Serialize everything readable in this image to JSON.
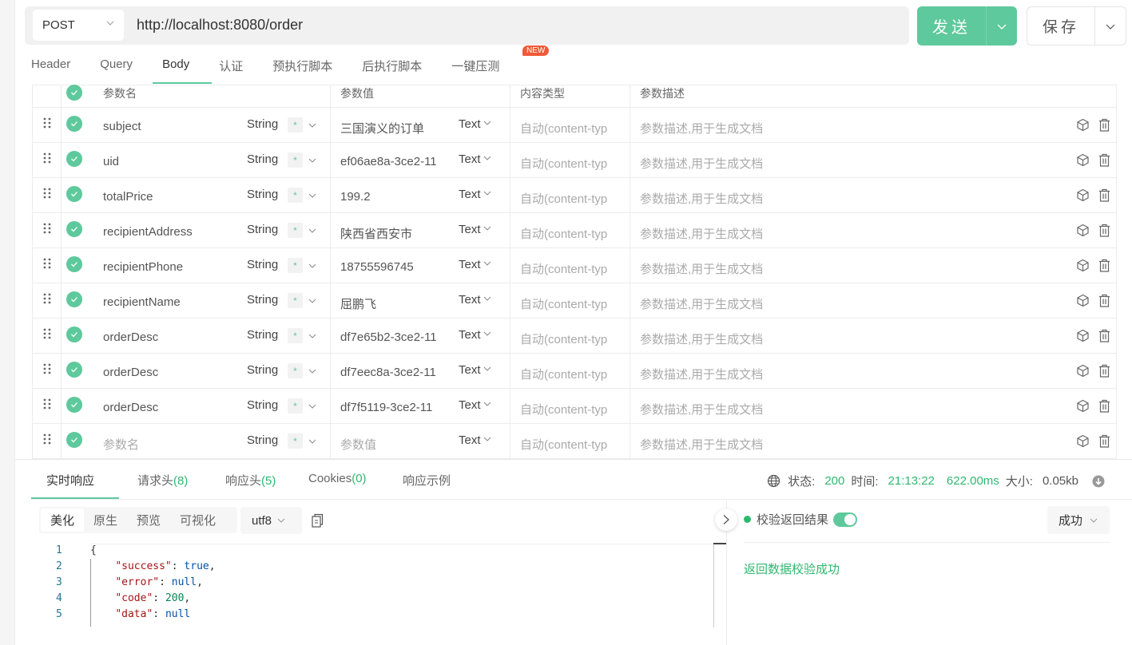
{
  "request": {
    "method": "POST",
    "url": "http://localhost:8080/order",
    "send_label": "发送",
    "save_label": "保存"
  },
  "tabs": [
    {
      "label": "Header"
    },
    {
      "label": "Query"
    },
    {
      "label": "Body",
      "active": true
    },
    {
      "label": "认证"
    },
    {
      "label": "预执行脚本"
    },
    {
      "label": "后执行脚本"
    },
    {
      "label": "一键压测"
    }
  ],
  "new_badge": "NEW",
  "params": {
    "headers": {
      "name": "参数名",
      "value": "参数值",
      "content_type": "内容类型",
      "description": "参数描述"
    },
    "rows": [
      {
        "name": "subject",
        "type": "String",
        "required": "*",
        "value": "三国演义的订单",
        "value_type": "Text",
        "content_type": "自动(content-typ",
        "description": "参数描述,用于生成文档"
      },
      {
        "name": "uid",
        "type": "String",
        "required": "*",
        "value": "ef06ae8a-3ce2-11",
        "value_type": "Text",
        "content_type": "自动(content-typ",
        "description": "参数描述,用于生成文档"
      },
      {
        "name": "totalPrice",
        "type": "String",
        "required": "*",
        "value": "199.2",
        "value_type": "Text",
        "content_type": "自动(content-typ",
        "description": "参数描述,用于生成文档"
      },
      {
        "name": "recipientAddress",
        "type": "String",
        "required": "*",
        "value": "陕西省西安市",
        "value_type": "Text",
        "content_type": "自动(content-typ",
        "description": "参数描述,用于生成文档"
      },
      {
        "name": "recipientPhone",
        "type": "String",
        "required": "*",
        "value": "18755596745",
        "value_type": "Text",
        "content_type": "自动(content-typ",
        "description": "参数描述,用于生成文档"
      },
      {
        "name": "recipientName",
        "type": "String",
        "required": "*",
        "value": "屈鹏飞",
        "value_type": "Text",
        "content_type": "自动(content-typ",
        "description": "参数描述,用于生成文档"
      },
      {
        "name": "orderDesc",
        "type": "String",
        "required": "*",
        "value": "df7e65b2-3ce2-11",
        "value_type": "Text",
        "content_type": "自动(content-typ",
        "description": "参数描述,用于生成文档"
      },
      {
        "name": "orderDesc",
        "type": "String",
        "required": "*",
        "value": "df7eec8a-3ce2-11",
        "value_type": "Text",
        "content_type": "自动(content-typ",
        "description": "参数描述,用于生成文档"
      },
      {
        "name": "orderDesc",
        "type": "String",
        "required": "*",
        "value": "df7f5119-3ce2-11",
        "value_type": "Text",
        "content_type": "自动(content-typ",
        "description": "参数描述,用于生成文档"
      }
    ],
    "placeholder_row": {
      "name": "参数名",
      "type": "String",
      "required": "*",
      "value": "参数值",
      "value_type": "Text",
      "content_type": "自动(content-typ",
      "description": "参数描述,用于生成文档"
    }
  },
  "response": {
    "tabs": [
      {
        "label": "实时响应",
        "count": ""
      },
      {
        "label": "请求头",
        "count": "(8)"
      },
      {
        "label": "响应头",
        "count": "(5)"
      },
      {
        "label": "Cookies",
        "count": "(0)"
      },
      {
        "label": "响应示例",
        "count": ""
      }
    ],
    "status": {
      "status_label": "状态:",
      "status_value": "200",
      "time_label": "时间:",
      "time_value": "21:13:22",
      "duration": "622.00ms",
      "size_label": "大小:",
      "size_value": "0.05kb"
    },
    "view_modes": [
      "美化",
      "原生",
      "预览",
      "可视化"
    ],
    "encoding": "utf8",
    "code_lines": [
      {
        "n": "1",
        "parts": [
          {
            "t": "{",
            "c": ""
          }
        ]
      },
      {
        "n": "2",
        "parts": [
          {
            "t": "    ",
            "c": ""
          },
          {
            "t": "\"success\"",
            "c": "k"
          },
          {
            "t": ": ",
            "c": ""
          },
          {
            "t": "true",
            "c": "kw"
          },
          {
            "t": ",",
            "c": ""
          }
        ]
      },
      {
        "n": "3",
        "parts": [
          {
            "t": "    ",
            "c": ""
          },
          {
            "t": "\"error\"",
            "c": "k"
          },
          {
            "t": ": ",
            "c": ""
          },
          {
            "t": "null",
            "c": "kw"
          },
          {
            "t": ",",
            "c": ""
          }
        ]
      },
      {
        "n": "4",
        "parts": [
          {
            "t": "    ",
            "c": ""
          },
          {
            "t": "\"code\"",
            "c": "k"
          },
          {
            "t": ": ",
            "c": ""
          },
          {
            "t": "200",
            "c": "num"
          },
          {
            "t": ",",
            "c": ""
          }
        ]
      },
      {
        "n": "5",
        "parts": [
          {
            "t": "    ",
            "c": ""
          },
          {
            "t": "\"data\"",
            "c": "k"
          },
          {
            "t": ": ",
            "c": ""
          },
          {
            "t": "null",
            "c": "kw"
          }
        ]
      }
    ],
    "verify": {
      "label": "校验返回结果",
      "enabled": true,
      "result_option": "成功",
      "message": "返回数据校验成功"
    }
  }
}
